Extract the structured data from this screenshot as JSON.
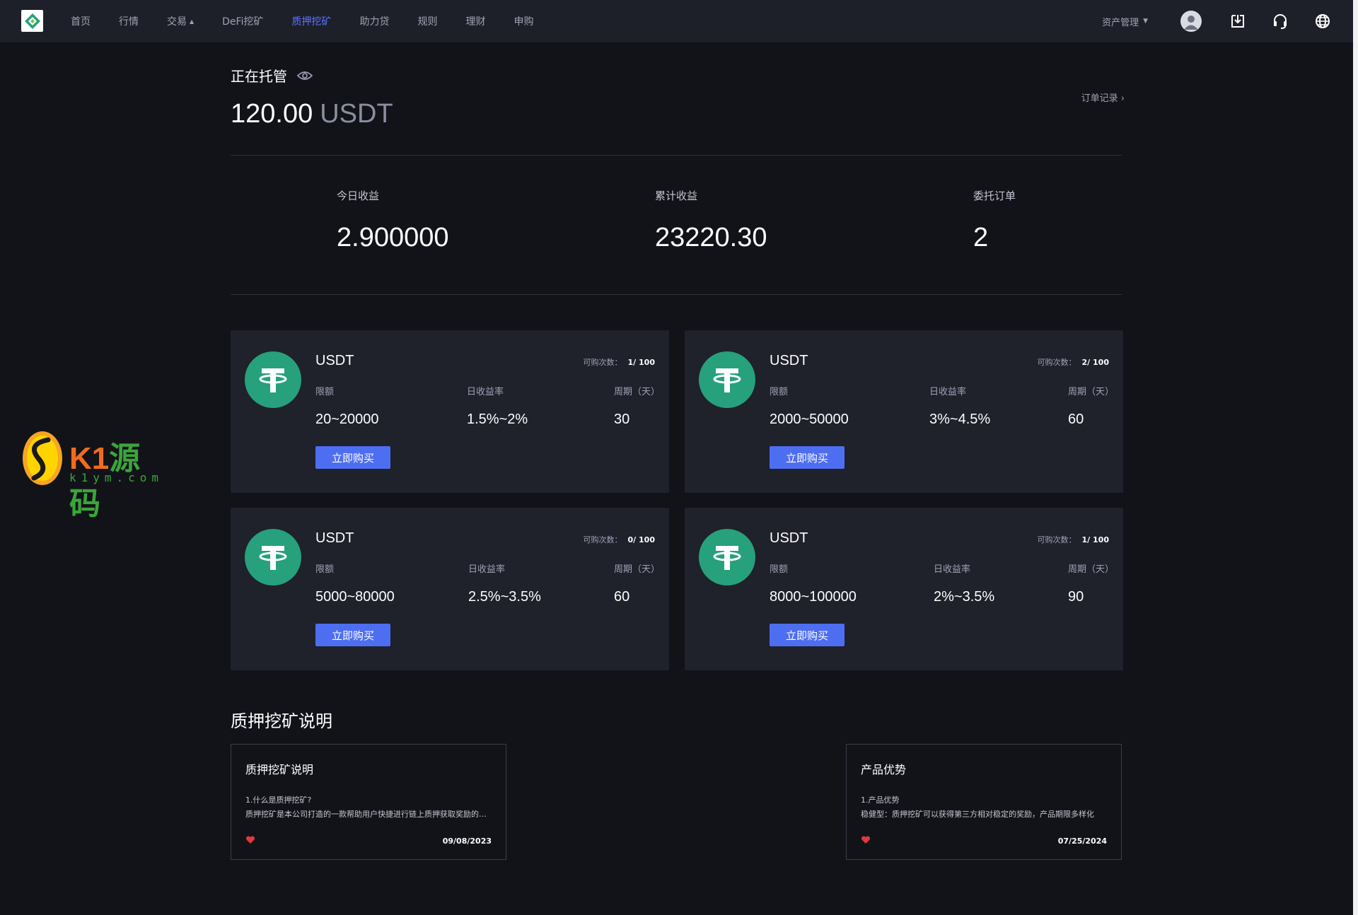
{
  "nav": {
    "links": [
      {
        "label": "首页"
      },
      {
        "label": "行情"
      },
      {
        "label": "交易"
      },
      {
        "label": "DeFi挖矿"
      },
      {
        "label": "质押挖矿"
      },
      {
        "label": "助力贷"
      },
      {
        "label": "规则"
      },
      {
        "label": "理财"
      },
      {
        "label": "申购"
      }
    ],
    "active_index": 4,
    "asset_menu": "资产管理",
    "icons": [
      "user-icon",
      "download-icon",
      "headset-icon",
      "globe-icon"
    ]
  },
  "holding": {
    "title": "正在托管",
    "amount": "120.00",
    "unit": "USDT",
    "order_link": "订单记录 ›"
  },
  "stats": [
    {
      "label": "今日收益",
      "value": "2.900000"
    },
    {
      "label": "累计收益",
      "value": "23220.30"
    },
    {
      "label": "委托订单",
      "value": "2"
    }
  ],
  "products": [
    {
      "name": "USDT",
      "quota_label": "可购次数：",
      "quota": "1/ 100",
      "limit_label": "限额",
      "limit": "20~20000",
      "rate_label": "日收益率",
      "rate": "1.5%~2%",
      "period_label": "周期（天）",
      "period": "30",
      "button": "立即购买"
    },
    {
      "name": "USDT",
      "quota_label": "可购次数：",
      "quota": "2/ 100",
      "limit_label": "限额",
      "limit": "2000~50000",
      "rate_label": "日收益率",
      "rate": "3%~4.5%",
      "period_label": "周期（天）",
      "period": "60",
      "button": "立即购买"
    },
    {
      "name": "USDT",
      "quota_label": "可购次数：",
      "quota": "0/ 100",
      "limit_label": "限额",
      "limit": "5000~80000",
      "rate_label": "日收益率",
      "rate": "2.5%~3.5%",
      "period_label": "周期（天）",
      "period": "60",
      "button": "立即购买"
    },
    {
      "name": "USDT",
      "quota_label": "可购次数：",
      "quota": "1/ 100",
      "limit_label": "限额",
      "limit": "8000~100000",
      "rate_label": "日收益率",
      "rate": "2%~3.5%",
      "period_label": "周期（天）",
      "period": "90",
      "button": "立即购买"
    }
  ],
  "explain": {
    "title": "质押挖矿说明",
    "cards": [
      {
        "title": "质押挖矿说明",
        "line1": "1.什么是质押挖矿?",
        "line2": "质押挖矿是本公司打造的一款帮助用户快捷进行链上质押获取奖励的工具产品",
        "date": "09/08/2023"
      },
      {
        "title": "产品优势",
        "line1": "1.产品优势",
        "line2": "稳健型：质押挖矿可以获得第三方相对稳定的奖励，产品期限多样化",
        "date": "07/25/2024"
      }
    ]
  },
  "watermark": {
    "brand_k": "K1",
    "brand_cn": "源码",
    "sub": "k1ym.com"
  },
  "colors": {
    "accent": "#4e6ef2",
    "active_nav": "#5b73ff",
    "tether": "#26a17b",
    "heart": "#e0393e"
  }
}
